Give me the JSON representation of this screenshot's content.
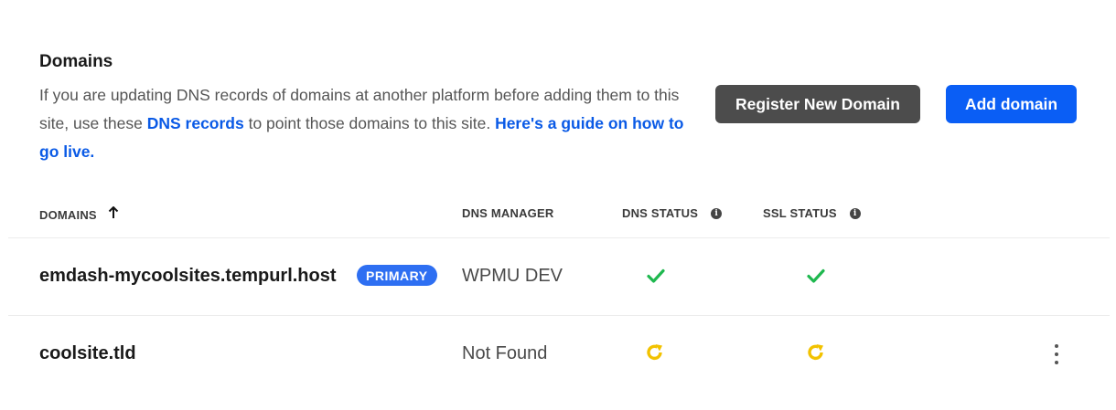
{
  "header": {
    "title": "Domains",
    "desc_part1": "If you are updating DNS records of domains at another platform before adding them to this site, use these ",
    "desc_link1": "DNS records",
    "desc_part2": " to point those domains to this site. ",
    "desc_link2": "Here's a guide on how to go live."
  },
  "buttons": {
    "register": "Register New Domain",
    "add": "Add domain"
  },
  "table": {
    "columns": {
      "domains": "DOMAINS",
      "dns_manager": "DNS MANAGER",
      "dns_status": "DNS STATUS",
      "ssl_status": "SSL STATUS"
    },
    "sort": "ascending",
    "rows": [
      {
        "domain": "emdash-mycoolsites.tempurl.host",
        "badge": "PRIMARY",
        "dns_manager": "WPMU DEV",
        "dns_status": "check",
        "ssl_status": "check"
      },
      {
        "domain": "coolsite.tld",
        "badge": "",
        "dns_manager": "Not Found",
        "dns_status": "pending",
        "ssl_status": "pending"
      }
    ]
  },
  "colors": {
    "link": "#0a5ae6",
    "primary_button": "#0a5ef5",
    "secondary_button": "#4c4c4c",
    "badge": "#2e6ff2",
    "success": "#1fb84f",
    "pending": "#f2c200"
  },
  "icons": {
    "sort": "arrow-up-icon",
    "info": "info-icon",
    "ok": "check-icon",
    "pending": "refresh-icon",
    "menu": "kebab-menu-icon"
  }
}
